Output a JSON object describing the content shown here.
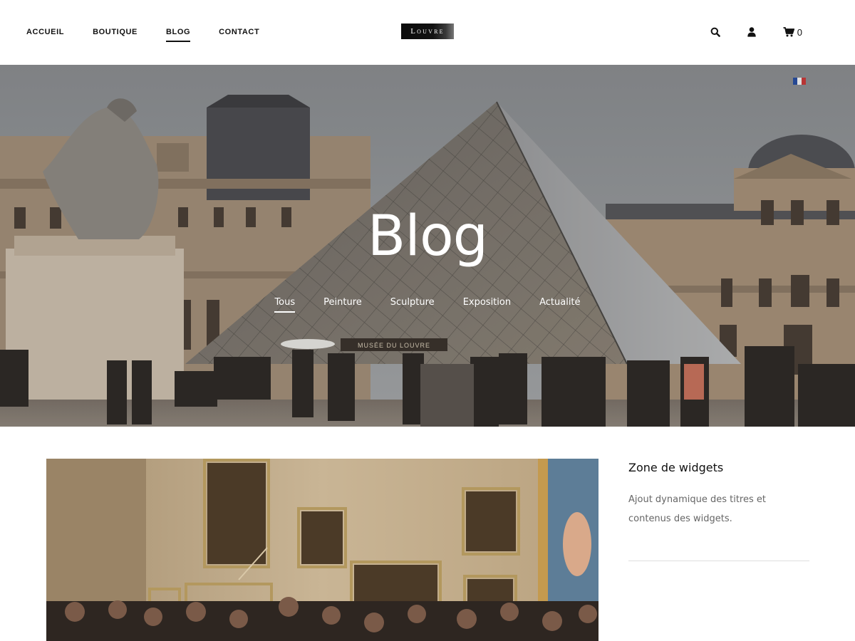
{
  "header": {
    "nav": [
      {
        "label": "ACCUEIL",
        "active": false
      },
      {
        "label": "BOUTIQUE",
        "active": false
      },
      {
        "label": "BLOG",
        "active": true
      },
      {
        "label": "CONTACT",
        "active": false
      }
    ],
    "logo_text": "Louvre",
    "icons": [
      "search-icon",
      "user-icon",
      "cart-icon"
    ],
    "cart_count": "0"
  },
  "hero": {
    "title": "Blog",
    "sign_text": "MUSÉE DU LOUVRE",
    "categories": [
      {
        "label": "Tous",
        "active": true
      },
      {
        "label": "Peinture",
        "active": false
      },
      {
        "label": "Sculpture",
        "active": false
      },
      {
        "label": "Exposition",
        "active": false
      },
      {
        "label": "Actualité",
        "active": false
      }
    ]
  },
  "sidebar": {
    "widget_title": "Zone de widgets",
    "widget_text": "Ajout dynamique des titres et contenus des widgets."
  },
  "colors": {
    "text": "#111111",
    "muted": "#666666",
    "divider": "#dedede",
    "sky": "#8e9194"
  }
}
